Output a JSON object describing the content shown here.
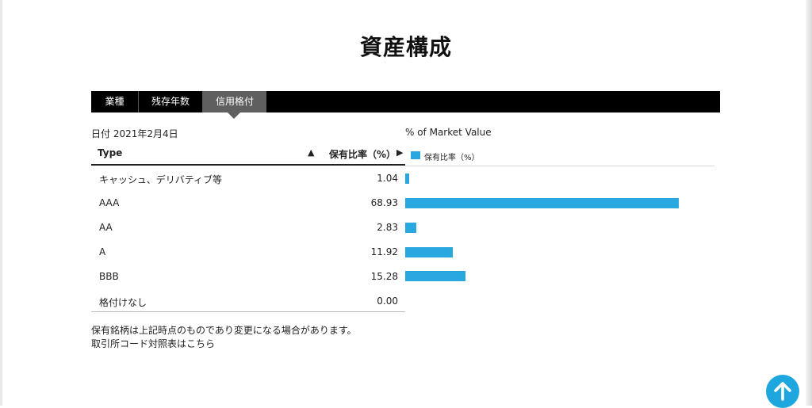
{
  "page": {
    "title": "資産構成"
  },
  "tabs": [
    {
      "label": "業種",
      "active": false
    },
    {
      "label": "残存年数",
      "active": false
    },
    {
      "label": "信用格付",
      "active": true
    }
  ],
  "table": {
    "date_label": "日付 2021年2月4日",
    "col_type": "Type",
    "col_ratio": "保有比率（%）",
    "sort_icon": "triangle-up-icon",
    "next_icon": "triangle-right-icon",
    "rows": [
      {
        "label": "キャッシュ、デリバティブ等",
        "value": "1.04"
      },
      {
        "label": "AAA",
        "value": "68.93"
      },
      {
        "label": "AA",
        "value": "2.83"
      },
      {
        "label": "A",
        "value": "11.92"
      },
      {
        "label": "BBB",
        "value": "15.28"
      },
      {
        "label": "格付けなし",
        "value": "0.00"
      }
    ]
  },
  "chart_data": {
    "type": "bar",
    "orientation": "horizontal",
    "title": "% of Market Value",
    "categories": [
      "キャッシュ、デリバティブ等",
      "AAA",
      "AA",
      "A",
      "BBB",
      "格付けなし"
    ],
    "series": [
      {
        "name": "保有比率（%）",
        "values": [
          1.04,
          68.93,
          2.83,
          11.92,
          15.28,
          0.0
        ]
      }
    ],
    "xlim": [
      0,
      80
    ],
    "legend": "top-left",
    "color": "#29a8e0"
  },
  "footer": {
    "note": "保有銘柄は上記時点のものであり変更になる場合があります。",
    "link_prefix": "取引所コード対照表は",
    "link_text": "こちら"
  },
  "scroll_top": {
    "icon": "arrow-up-icon",
    "color": "#1ea7df"
  }
}
